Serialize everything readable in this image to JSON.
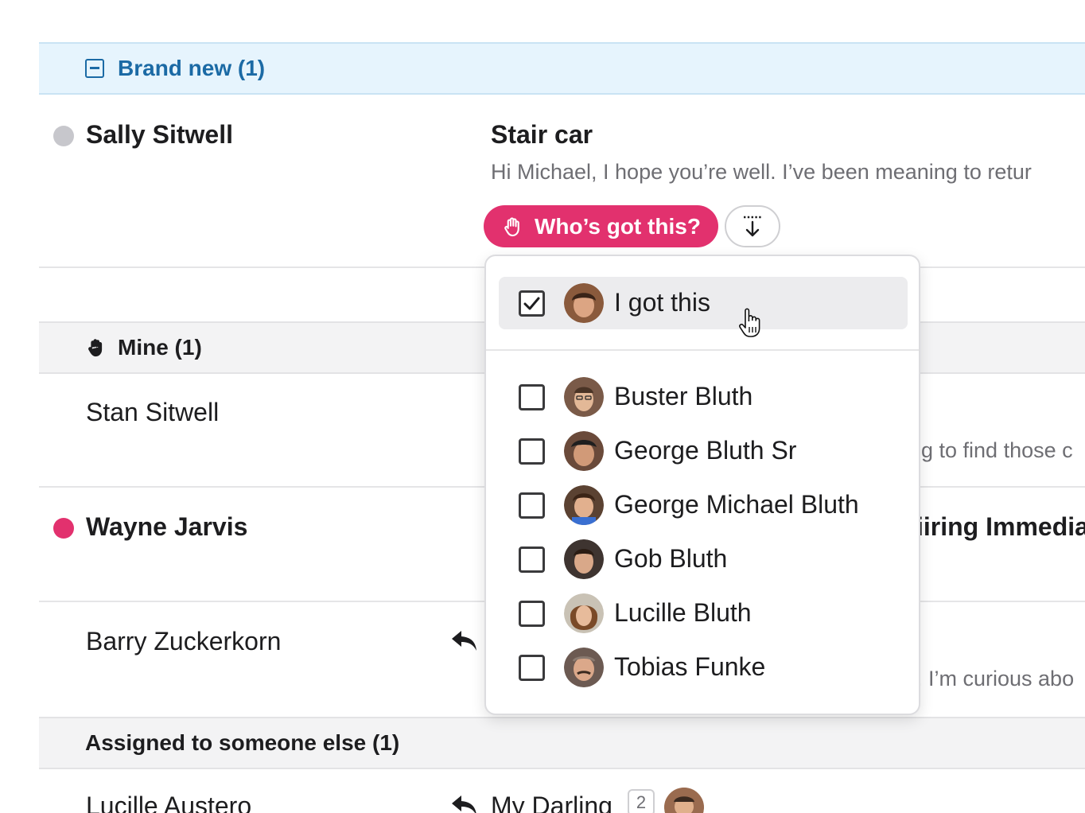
{
  "sections": {
    "brand_new": {
      "label": "Brand new (1)"
    },
    "mine": {
      "label": "Mine (1)"
    },
    "assigned_else": {
      "label": "Assigned to someone else (1)"
    }
  },
  "rows": {
    "sally": {
      "name": "Sally Sitwell",
      "subject": "Stair car",
      "preview": "Hi Michael, I hope you’re well. I’ve been meaning to retur",
      "status_color": "#c7c7cc"
    },
    "stan": {
      "name": "Stan Sitwell",
      "preview_fragment": "g to find those c"
    },
    "wayne": {
      "name": "Wayne Jarvis",
      "subject_fragment": "iiring Immedia",
      "status_color": "#e2316e"
    },
    "barry": {
      "name": "Barry Zuckerkorn",
      "preview_fragment": ". I’m curious abo"
    },
    "lucille_a": {
      "name": "Lucille Austero",
      "subject": "My Darling",
      "count": "2"
    }
  },
  "actions": {
    "whos_got_this": "Who’s got this?",
    "accent": "#e2316e"
  },
  "assign_menu": {
    "self_item": {
      "label": "I got this",
      "checked": true
    },
    "people": [
      {
        "label": "Buster Bluth",
        "checked": false
      },
      {
        "label": "George Bluth Sr",
        "checked": false
      },
      {
        "label": "George Michael Bluth",
        "checked": false
      },
      {
        "label": "Gob Bluth",
        "checked": false
      },
      {
        "label": "Lucille Bluth",
        "checked": false
      },
      {
        "label": "Tobias Funke",
        "checked": false
      }
    ]
  }
}
